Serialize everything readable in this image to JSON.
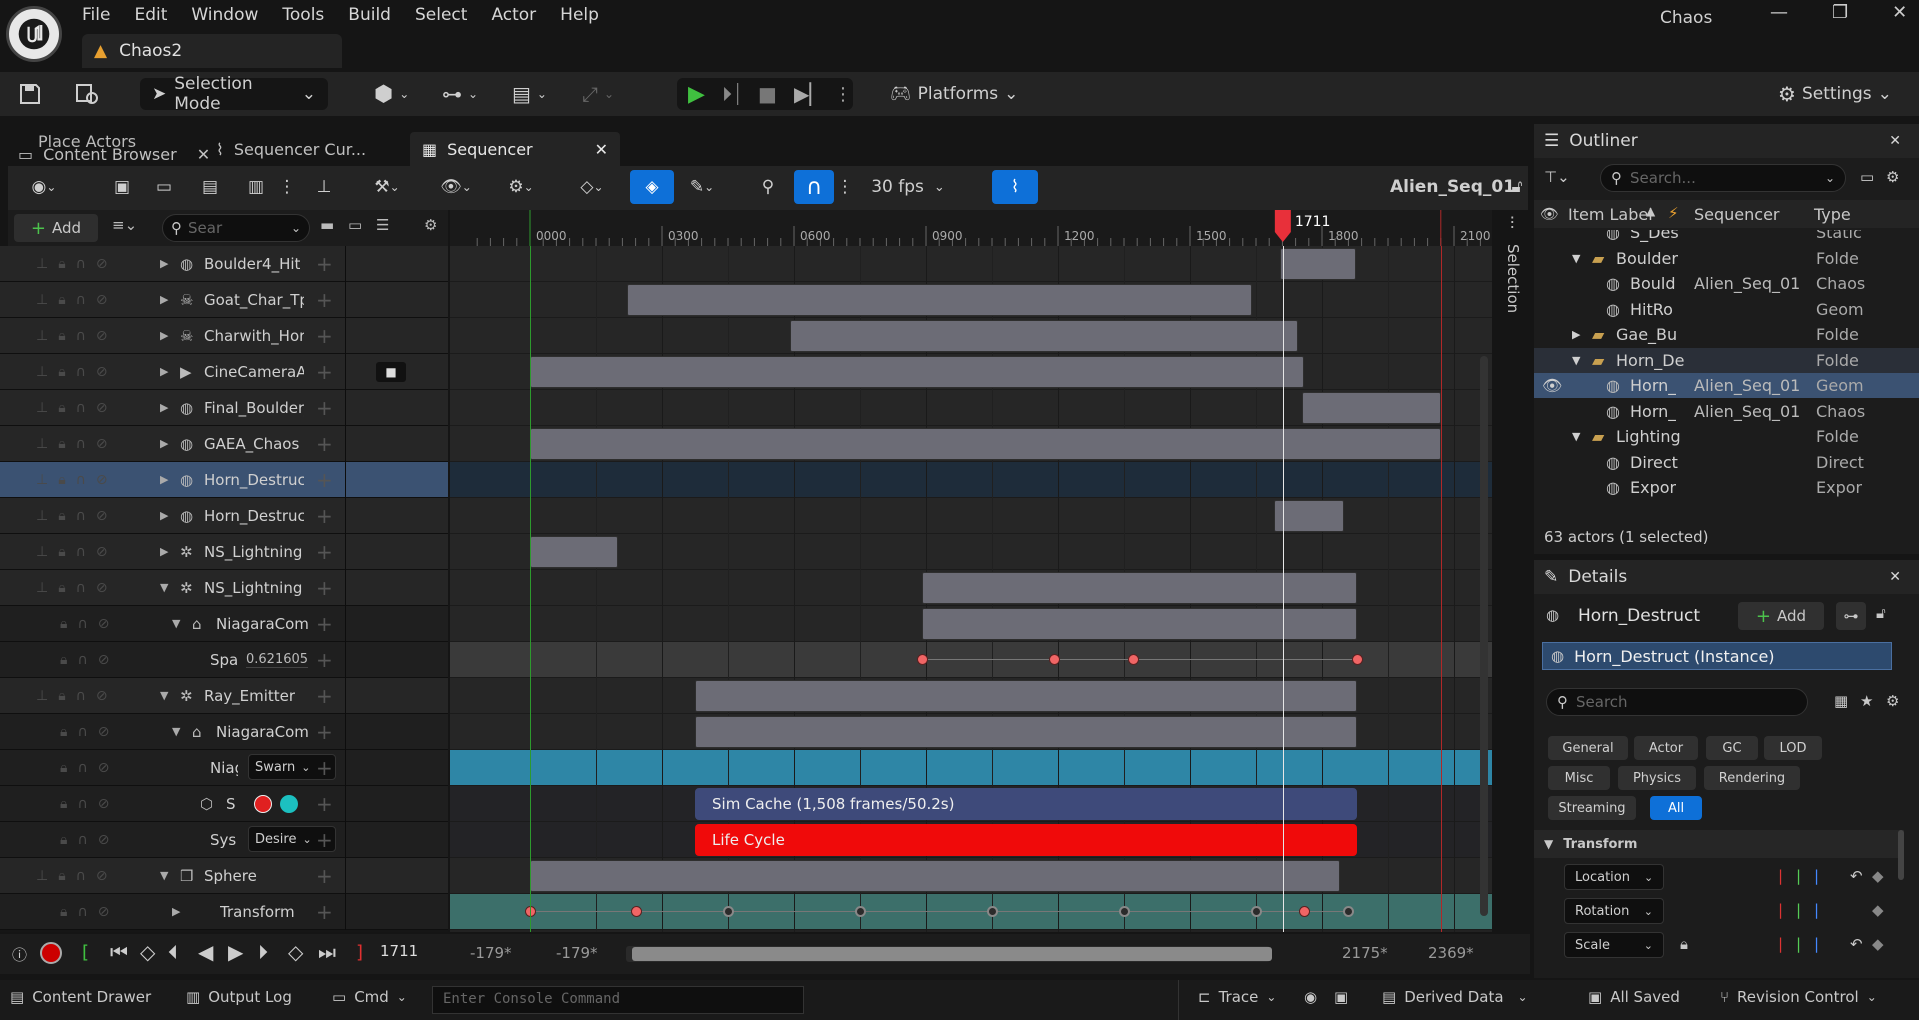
{
  "app": {
    "title": "Chaos",
    "doc_tab": "Chaos2"
  },
  "menus": [
    "File",
    "Edit",
    "Window",
    "Tools",
    "Build",
    "Select",
    "Actor",
    "Help"
  ],
  "toolbar": {
    "selection_mode": "Selection Mode",
    "platforms": "Platforms",
    "settings": "Settings"
  },
  "tabs": {
    "place_actors": "Place Actors",
    "content_browser": "Content Browser",
    "sequencer_curve": "Sequencer Cur...",
    "sequencer": "Sequencer"
  },
  "sequencer": {
    "fps": "30 fps",
    "sequence_name": "Alien_Seq_01",
    "add_label": "Add",
    "search_placeholder": "Sear",
    "current_frame": "1711",
    "ruler_ticks": [
      "0000",
      "0300",
      "0600",
      "0900",
      "1200",
      "1500",
      "1800",
      "2100"
    ],
    "side_tab": "Selection",
    "tracks": [
      {
        "label": "Boulder4_Hit",
        "icon": "geometry-collection-icon"
      },
      {
        "label": "Goat_Char_Tp",
        "icon": "skeletal-mesh-icon"
      },
      {
        "label": "Charwith_Horr",
        "icon": "skeletal-mesh-icon"
      },
      {
        "label": "CineCameraAc",
        "icon": "camera-icon"
      },
      {
        "label": "Final_Boulder_",
        "icon": "geometry-collection-icon"
      },
      {
        "label": "GAEA_Chaos",
        "icon": "geometry-collection-icon"
      },
      {
        "label": "Horn_Destruct",
        "icon": "geometry-collection-icon"
      },
      {
        "label": "Horn_Destruct",
        "icon": "geometry-collection-icon"
      },
      {
        "label": "NS_Lightning",
        "icon": "niagara-icon"
      },
      {
        "label": "NS_Lightning",
        "icon": "niagara-icon"
      },
      {
        "label": "NiagaraCom",
        "icon": "niagara-component-icon"
      },
      {
        "label": "Spa",
        "value": "0.621605"
      },
      {
        "label": "Ray_Emitter",
        "icon": "niagara-icon"
      },
      {
        "label": "NiagaraCom",
        "icon": "niagara-component-icon"
      },
      {
        "label": "Niag",
        "dropdown": "Swarn"
      },
      {
        "label": "S"
      },
      {
        "label": "Sys",
        "dropdown": "Desire"
      },
      {
        "label": "Sphere",
        "icon": "static-mesh-icon"
      },
      {
        "label": "Transform"
      }
    ],
    "sections": {
      "sim_cache": "Sim Cache (1,508 frames/50.2s)",
      "life_cycle": "Life Cycle"
    },
    "range": {
      "view_start": "-179*",
      "play_start": "-179*",
      "play_end": "2175*",
      "view_end": "2369*"
    }
  },
  "outliner": {
    "title": "Outliner",
    "search_placeholder": "Search...",
    "columns": [
      "Item Label",
      "Sequencer",
      "Type"
    ],
    "rows": [
      {
        "label": "S_Des",
        "seq": "",
        "type": "Static"
      },
      {
        "label": "Boulder",
        "seq": "",
        "type": "Folde"
      },
      {
        "label": "Bould",
        "seq": "Alien_Seq_01",
        "type": "Chaos"
      },
      {
        "label": "HitRo",
        "seq": "",
        "type": "Geom"
      },
      {
        "label": "Gae_Bu",
        "seq": "",
        "type": "Folde"
      },
      {
        "label": "Horn_De",
        "seq": "",
        "type": "Folde"
      },
      {
        "label": "Horn_",
        "seq": "Alien_Seq_01",
        "type": "Geom"
      },
      {
        "label": "Horn_",
        "seq": "Alien_Seq_01",
        "type": "Chaos"
      },
      {
        "label": "Lighting",
        "seq": "",
        "type": "Folde"
      },
      {
        "label": "Direct",
        "seq": "",
        "type": "Direct"
      },
      {
        "label": "Expor",
        "seq": "",
        "type": "Expor"
      }
    ],
    "footer": "63 actors (1 selected)"
  },
  "details": {
    "title": "Details",
    "object_name": "Horn_Destruct",
    "add_label": "Add",
    "instance": "Horn_Destruct (Instance)",
    "search_placeholder": "Search",
    "filters": [
      "General",
      "Actor",
      "GC",
      "LOD",
      "Misc",
      "Physics",
      "Rendering",
      "Streaming",
      "All"
    ],
    "section": "Transform",
    "fields": [
      {
        "label": "Location"
      },
      {
        "label": "Rotation"
      },
      {
        "label": "Scale"
      }
    ]
  },
  "statusbar": {
    "content_drawer": "Content Drawer",
    "output_log": "Output Log",
    "cmd": "Cmd",
    "console_placeholder": "Enter Console Command",
    "trace": "Trace",
    "derived_data": "Derived Data",
    "all_saved": "All Saved",
    "revision_control": "Revision Control"
  },
  "colors": {
    "accent": "#0e70d8",
    "playhead": "#e8303a",
    "life_cycle": "#f00a0a",
    "sim_cache": "#3e4a7a",
    "niagara_lane": "#2e86a6",
    "transform_lane": "#3c6f6a"
  }
}
